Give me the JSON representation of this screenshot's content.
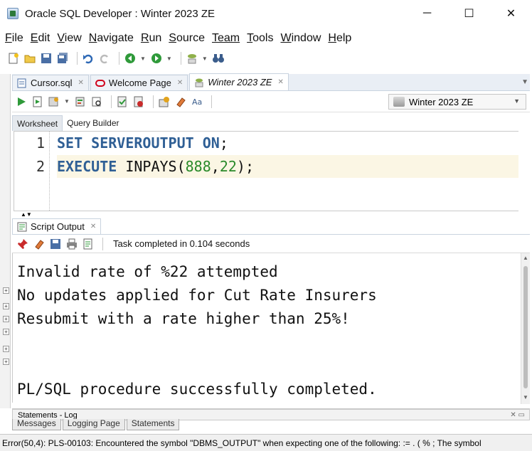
{
  "window": {
    "title": "Oracle SQL Developer : Winter 2023 ZE",
    "minimize": "─",
    "maximize": "☐",
    "close": "✕"
  },
  "menu": [
    {
      "label": "File",
      "u": "F",
      "rest": "ile"
    },
    {
      "label": "Edit",
      "u": "E",
      "rest": "dit"
    },
    {
      "label": "View",
      "u": "V",
      "rest": "iew"
    },
    {
      "label": "Navigate",
      "u": "N",
      "rest": "avigate"
    },
    {
      "label": "Run",
      "u": "R",
      "rest": "un"
    },
    {
      "label": "Source",
      "u": "S",
      "rest": "ource"
    },
    {
      "label": "Team",
      "u": "",
      "rest": "Team"
    },
    {
      "label": "Tools",
      "u": "T",
      "rest": "ools"
    },
    {
      "label": "Window",
      "u": "W",
      "rest": "indow"
    },
    {
      "label": "Help",
      "u": "H",
      "rest": "elp"
    }
  ],
  "doc_tabs": [
    {
      "label": "Cursor.sql",
      "icon": "sql-file-icon"
    },
    {
      "label": "Welcome Page",
      "icon": "oracle-icon"
    },
    {
      "label": "Winter 2023 ZE",
      "icon": "worksheet-icon",
      "active": true
    }
  ],
  "connection": "Winter 2023 ZE",
  "sub_tabs": {
    "worksheet": "Worksheet",
    "query_builder": "Query Builder"
  },
  "code": {
    "line1_num": "1",
    "line2_num": "2",
    "line1_kw1": "SET",
    "line1_kw2": "SERVEROUTPUT",
    "line1_kw3": "ON",
    "line1_end": ";",
    "line2_kw": "EXECUTE",
    "line2_proc": "INPAYS(",
    "line2_arg1": "888",
    "line2_comma": ",",
    "line2_arg2": "22",
    "line2_end": ");"
  },
  "output": {
    "tab_label": "Script Output",
    "status": "Task completed in 0.104 seconds",
    "lines": [
      "Invalid rate of %22 attempted",
      "No updates applied for Cut Rate Insurers",
      "Resubmit with a rate higher than 25%!",
      "",
      "",
      "PL/SQL procedure successfully completed."
    ]
  },
  "log": {
    "header": "Statements - Log",
    "tabs": [
      "Messages",
      "Logging Page",
      "Statements"
    ]
  },
  "statusbar": "Error(50,4): PLS-00103: Encountered the symbol \"DBMS_OUTPUT\" when expecting one of the following:    := . ( % ; The symbol",
  "colors": {
    "keyword": "#2f5f95",
    "number": "#2a8a2a",
    "current_line": "#fbf6e4"
  }
}
